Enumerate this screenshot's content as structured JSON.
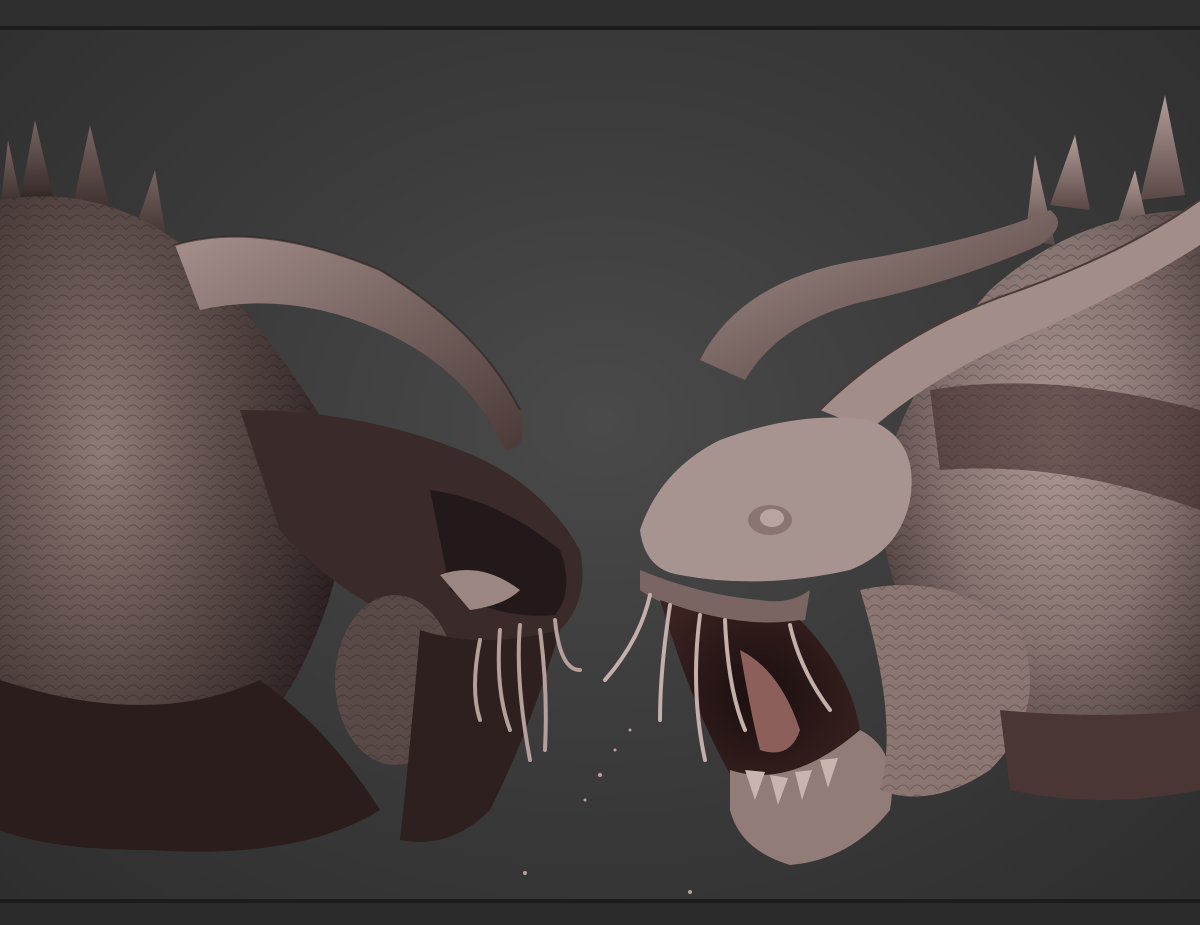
{
  "scene": {
    "subject": "",
    "colors": {
      "background_top": "#2f2f2f",
      "background_center": "#4a4a4a",
      "border_dark": "#1c1c1c",
      "sculpt_light": "#a08a86",
      "sculpt_mid": "#6e5d5a",
      "sculpt_shadow": "#2a1e1e",
      "flesh_dark": "#3a1f1f"
    }
  }
}
